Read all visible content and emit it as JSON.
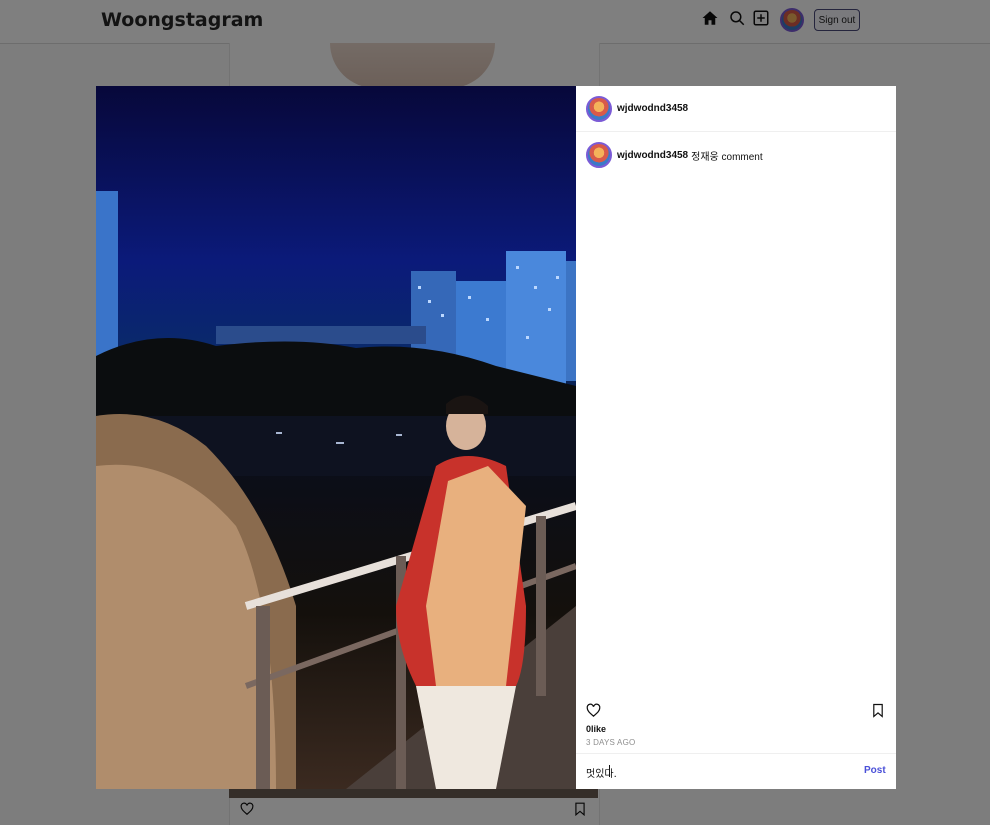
{
  "app": {
    "title": "Woongstagram"
  },
  "header": {
    "signout_label": "Sign out",
    "icons": [
      "home-icon",
      "search-icon",
      "add-post-icon",
      "profile-avatar"
    ]
  },
  "modal": {
    "author": "wjdwodnd3458",
    "comments": [
      {
        "username": "wjdwodnd3458",
        "text": "정재웅 comment"
      }
    ],
    "likes_text": "0like",
    "time_ago": "3 DAYS AGO",
    "comment_input_value": "멋있다.",
    "post_label": "Post"
  },
  "colors": {
    "accent": "#4a50d8",
    "avatar_ring": "#7b5bd6"
  }
}
